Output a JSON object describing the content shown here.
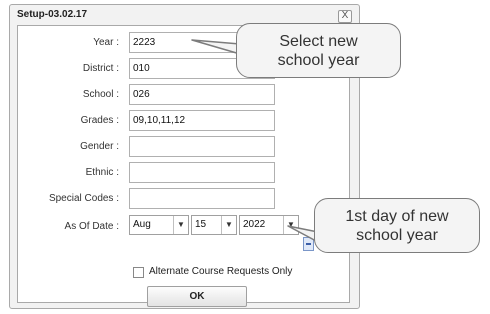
{
  "dialog": {
    "title": "Setup-03.02.17",
    "close_label": "X"
  },
  "form": {
    "year_label": "Year :",
    "year_value": "2223",
    "district_label": "District :",
    "district_value": "010",
    "school_label": "School :",
    "school_value": "026",
    "grades_label": "Grades :",
    "grades_value": "09,10,11,12",
    "gender_label": "Gender :",
    "gender_value": "",
    "ethnic_label": "Ethnic :",
    "ethnic_value": "",
    "special_codes_label": "Special Codes :",
    "special_codes_value": "",
    "as_of_date_label": "As Of Date :",
    "as_of_month": "Aug",
    "as_of_day": "15",
    "as_of_year": "2022",
    "alternate_label": "Alternate Course Requests Only",
    "alternate_checked": false,
    "ok_label": "OK"
  },
  "callouts": {
    "year_note_line1": "Select new",
    "year_note_line2": "school year",
    "date_note_line1": "1st day of new",
    "date_note_line2": "school year"
  }
}
